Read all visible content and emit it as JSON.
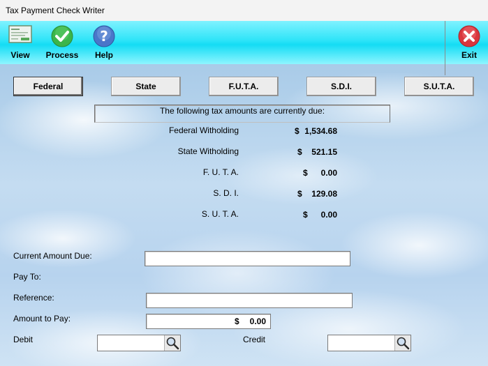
{
  "window": {
    "title": "Tax Payment Check Writer"
  },
  "toolbar": {
    "view_label": "View",
    "process_label": "Process",
    "help_label": "Help",
    "exit_label": "Exit"
  },
  "tabs": [
    {
      "label": "Federal",
      "active": true
    },
    {
      "label": "State",
      "active": false
    },
    {
      "label": "F.U.T.A.",
      "active": false
    },
    {
      "label": "S.D.I.",
      "active": false
    },
    {
      "label": "S.U.T.A.",
      "active": false
    }
  ],
  "due": {
    "header": "The following tax amounts are currently due:",
    "items": [
      {
        "label": "Federal Witholding",
        "currency": "$",
        "amount": "1,534.68"
      },
      {
        "label": "State Witholding",
        "currency": "$",
        "amount": "521.15"
      },
      {
        "label": "F. U. T. A.",
        "currency": "$",
        "amount": "0.00"
      },
      {
        "label": "S. D. I.",
        "currency": "$",
        "amount": "129.08"
      },
      {
        "label": "S. U. T. A.",
        "currency": "$",
        "amount": "0.00"
      }
    ]
  },
  "form": {
    "current_amount_due_label": "Current Amount Due:",
    "current_amount_due_value": "",
    "pay_to_label": "Pay To:",
    "reference_label": "Reference:",
    "reference_value": "",
    "amount_to_pay_label": "Amount to Pay:",
    "amount_to_pay_currency": "$",
    "amount_to_pay_value": "0.00",
    "debit_label": "Debit",
    "debit_value": "",
    "credit_label": "Credit",
    "credit_value": ""
  },
  "icons": {
    "view": "check-document-icon",
    "process": "green-checkmark-icon",
    "help": "blue-question-icon",
    "exit": "red-x-icon",
    "lookup": "magnifier-icon"
  },
  "colors": {
    "toolbar": "#14dcf4",
    "process": "#3bb54a",
    "help": "#4a76c9",
    "exit": "#d9363e"
  }
}
